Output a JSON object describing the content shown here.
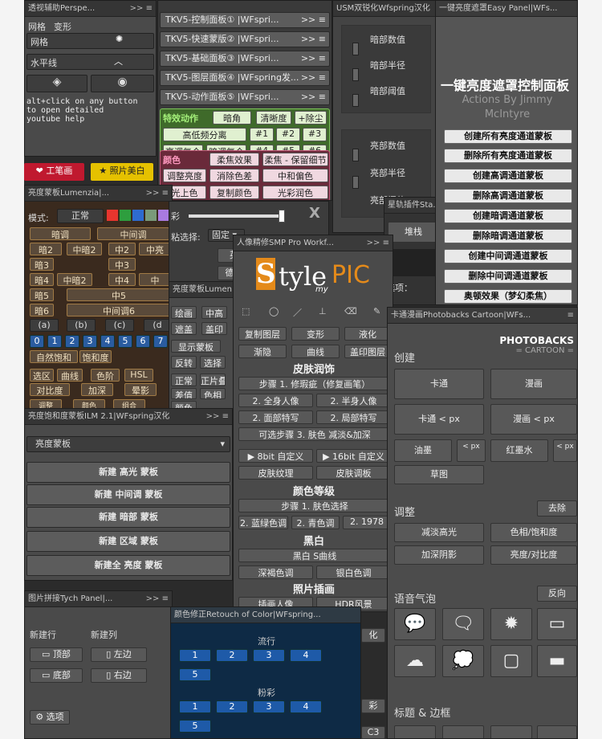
{
  "p_persp": {
    "title": "透视辅助Perspe...",
    "ctl": ">> ≡",
    "tabs": [
      "网格",
      "变形"
    ],
    "items": [
      "网格",
      "水平线"
    ],
    "help": "alt+click on any button\nto open detailed\nyoutube help"
  },
  "p_bottom_buttons": {
    "left": "工笔画",
    "right": "照片美白"
  },
  "p_tkv": {
    "rows": [
      "TKV5-控制面板① |WFspri...",
      "TKV5-快速蒙版② |WFspri...",
      "TKV5-基础面板③ |WFspri...",
      "TKV5-图层面板④ |WFspring发...",
      "TKV5-动作面板⑤ |WFspri..."
    ],
    "ctl": ">> ≡",
    "g1": [
      "特效动作",
      "暗角",
      "清晰度",
      "+除尘",
      "高低频分离",
      "#1",
      "#2",
      "#3",
      "亮调复合",
      "暗调复合",
      "#4",
      "#5",
      "#6"
    ],
    "g2": [
      "颜色",
      "柔焦效果",
      "柔焦 - 保留细节",
      "调整亮度",
      "消除色差",
      "中和偏色",
      "光上色",
      "复制颜色",
      "光彩润色"
    ]
  },
  "p_usm": {
    "title": "USM双锐化Wfspring汉化",
    "rows": [
      "暗部数值",
      "暗部半径",
      "暗部阈值",
      "亮部数值",
      "亮部半径",
      "亮部阈值"
    ]
  },
  "p_star": {
    "title": "星轨插件Sta...",
    "btn": "堆栈",
    "label": "选项："
  },
  "p_easy": {
    "title": "一键亮度遮罩Easy Panel|WFs...",
    "heading": "一键亮度遮罩控制面板",
    "sub1": "Actions By Jimmy",
    "sub2": "McIntyre",
    "buttons": [
      "创建所有亮度通道蒙板",
      "删除所有亮度通道蒙板",
      "创建高调通道蒙板",
      "删除高调通道蒙板",
      "创建暗调通道蒙板",
      "删除暗调通道蒙板",
      "创建中间调通道蒙板",
      "删除中间调通道蒙板",
      "奥顿效果（梦幻柔焦）"
    ]
  },
  "p_lum": {
    "title": "亮度蒙板Lumenzia|...",
    "ctl": ">> ≡",
    "mode_label": "模式:",
    "mode_val": "正常",
    "swatches": [
      "#e8352e",
      "#2e9e3e",
      "#2e6bd0",
      "#7a9a7a",
      "#a97ae0"
    ],
    "r1": [
      "暗调",
      "中间调"
    ],
    "r2": [
      "暗2",
      "中暗2",
      "中2",
      "中亮"
    ],
    "r3": [
      "暗3",
      "中3"
    ],
    "r4": [
      "暗4",
      "中暗2",
      "中4",
      "中"
    ],
    "r5": [
      "暗5",
      "中5"
    ],
    "r6": [
      "暗6",
      "中间调6"
    ],
    "r7": [
      "(a)",
      "(b)",
      "(c)",
      "(d"
    ],
    "nums": [
      "0",
      "1",
      "2",
      "3",
      "4",
      "5",
      "6",
      "7"
    ],
    "r9": [
      "自然饱和",
      "饱和度"
    ],
    "r10": [
      "选区",
      "曲线",
      "色阶",
      "HSL"
    ],
    "r11": [
      "对比度",
      "加深",
      "晕影"
    ],
    "r12": [
      "调整",
      "颜色",
      "组合"
    ]
  },
  "p_mid": {
    "slider_label": "彩",
    "select_label": "粘选择:",
    "select_val": "固定",
    "langs": [
      "英文",
      "德语文"
    ]
  },
  "p_lum2": {
    "title": "亮度蒙板Lumen",
    "btns": [
      "绘画",
      "中高",
      "遮盖",
      "盖印",
      "显示蒙板",
      "反转",
      "选择",
      "正常",
      "正片叠",
      "差值",
      "色相",
      "颜色"
    ]
  },
  "p_smp": {
    "title": "人像精修SMP Pro Workf...",
    "ctl": ">> ≡",
    "logo1": "S",
    "logo2": "tyle",
    "logo3": "PIC",
    "logo4": "my",
    "r1": [
      "复制图层",
      "变形",
      "液化"
    ],
    "r2": [
      "渐隐",
      "曲线",
      "盖印图层"
    ],
    "s1": "皮肤润饰",
    "a1": "步骤 1. 修瑕疵（修复画笔）",
    "a2": [
      "2. 全身人像",
      "2. 半身人像"
    ],
    "a3": [
      "2. 面部特写",
      "2. 局部特写"
    ],
    "a4": "可选步骤 3. 肤色 减淡&加深",
    "a5": [
      "▶ 8bit 自定义",
      "▶ 16bit 自定义"
    ],
    "a6": [
      "皮肤纹理",
      "皮肤调板"
    ],
    "s2": "颜色等级",
    "c1": "步骤 1. 肤色选择",
    "c2": [
      "2. 蓝绿色调",
      "2. 青色调",
      "2. 1978"
    ],
    "s3": "黑白",
    "d1": "黑白 S曲线",
    "d2": [
      "深褐色调",
      "银白色调"
    ],
    "s4": "照片插画",
    "e1": [
      "插画人像",
      "HDR风景"
    ]
  },
  "p_ilm": {
    "title": "亮度饱和度蒙板ILM 2.1|WFspring汉化",
    "ctl": ">> ≡",
    "dropdown": "亮度蒙板",
    "buttons": [
      "新建 高光 蒙板",
      "新建 中间调 蒙板",
      "新建 暗部 蒙板",
      "新建 区域 蒙板",
      "新建全 亮度 蒙板"
    ]
  },
  "p_cartoon": {
    "title": "卡通漫画Photobacks Cartoon|WFs...",
    "ctl": "≡",
    "brand1": "PHOTOBACKS",
    "brand2": "= CARTOON =",
    "create": "创建",
    "b1": [
      "卡通",
      "漫画"
    ],
    "b2": [
      "卡通 < px",
      "漫画 < px"
    ],
    "b3": [
      "油墨",
      "< px",
      "红墨水",
      "< px"
    ],
    "b4": "草图",
    "adjust": "调整",
    "remove": "去除",
    "c1": [
      "减淡高光",
      "色相/饱和度"
    ],
    "c2": [
      "加深阴影",
      "亮度/对比度"
    ],
    "bubble": "语音气泡",
    "reverse": "反向",
    "title2": "标题 & 边框"
  },
  "p_tych": {
    "title": "图片拼接Tych Panel|...",
    "ctl": ">> ≡",
    "new_row": "新建行",
    "new_col": "新建列",
    "b": [
      "顶部",
      "左边",
      "底部",
      "右边"
    ],
    "opt": "选项"
  },
  "p_retouch": {
    "title": "颜色修正Retouch of Color|WFspring...",
    "s1": "流行",
    "n1": [
      "1",
      "2",
      "3",
      "4",
      "5"
    ],
    "s2": "粉彩",
    "n2": [
      "1",
      "2",
      "3",
      "4",
      "5"
    ]
  },
  "p_side": {
    "items": [
      "化",
      "彩",
      "C3"
    ]
  }
}
